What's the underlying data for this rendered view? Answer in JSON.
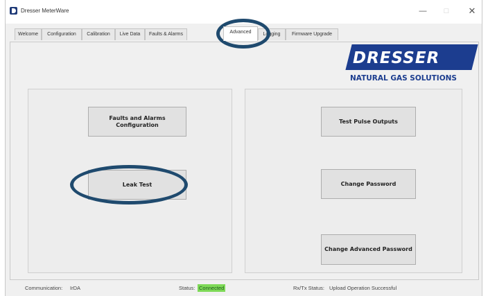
{
  "window": {
    "title": "Dresser MeterWare",
    "min_glyph": "—",
    "max_glyph": "□",
    "close_glyph": "✕"
  },
  "tabs": [
    {
      "label": "Welcome"
    },
    {
      "label": "Configuration"
    },
    {
      "label": "Calibration"
    },
    {
      "label": "Live Data"
    },
    {
      "label": "Faults & Alarms"
    },
    {
      "label": "Advanced",
      "active": true
    },
    {
      "label": "Logging"
    },
    {
      "label": "Firmware Upgrade"
    }
  ],
  "logo": {
    "word": "DRESSER",
    "tagline": "NATURAL GAS SOLUTIONS",
    "color": "#1c3d8f"
  },
  "buttons": {
    "faults_alarms_config": "Faults and Alarms Configuration",
    "leak_test": "Leak Test",
    "test_pulse_outputs": "Test Pulse Outputs",
    "change_password": "Change Password",
    "change_advanced_password": "Change Advanced Password"
  },
  "status": {
    "communication_label": "Communication:",
    "communication_value": "IrDA",
    "status_label": "Status:",
    "status_value": "Connected",
    "status_color": "#7ed957",
    "rxtx_label": "Rx/Tx Status:",
    "rxtx_value": "Upload Operation Successful"
  },
  "callout_color": "#1f4a6e"
}
